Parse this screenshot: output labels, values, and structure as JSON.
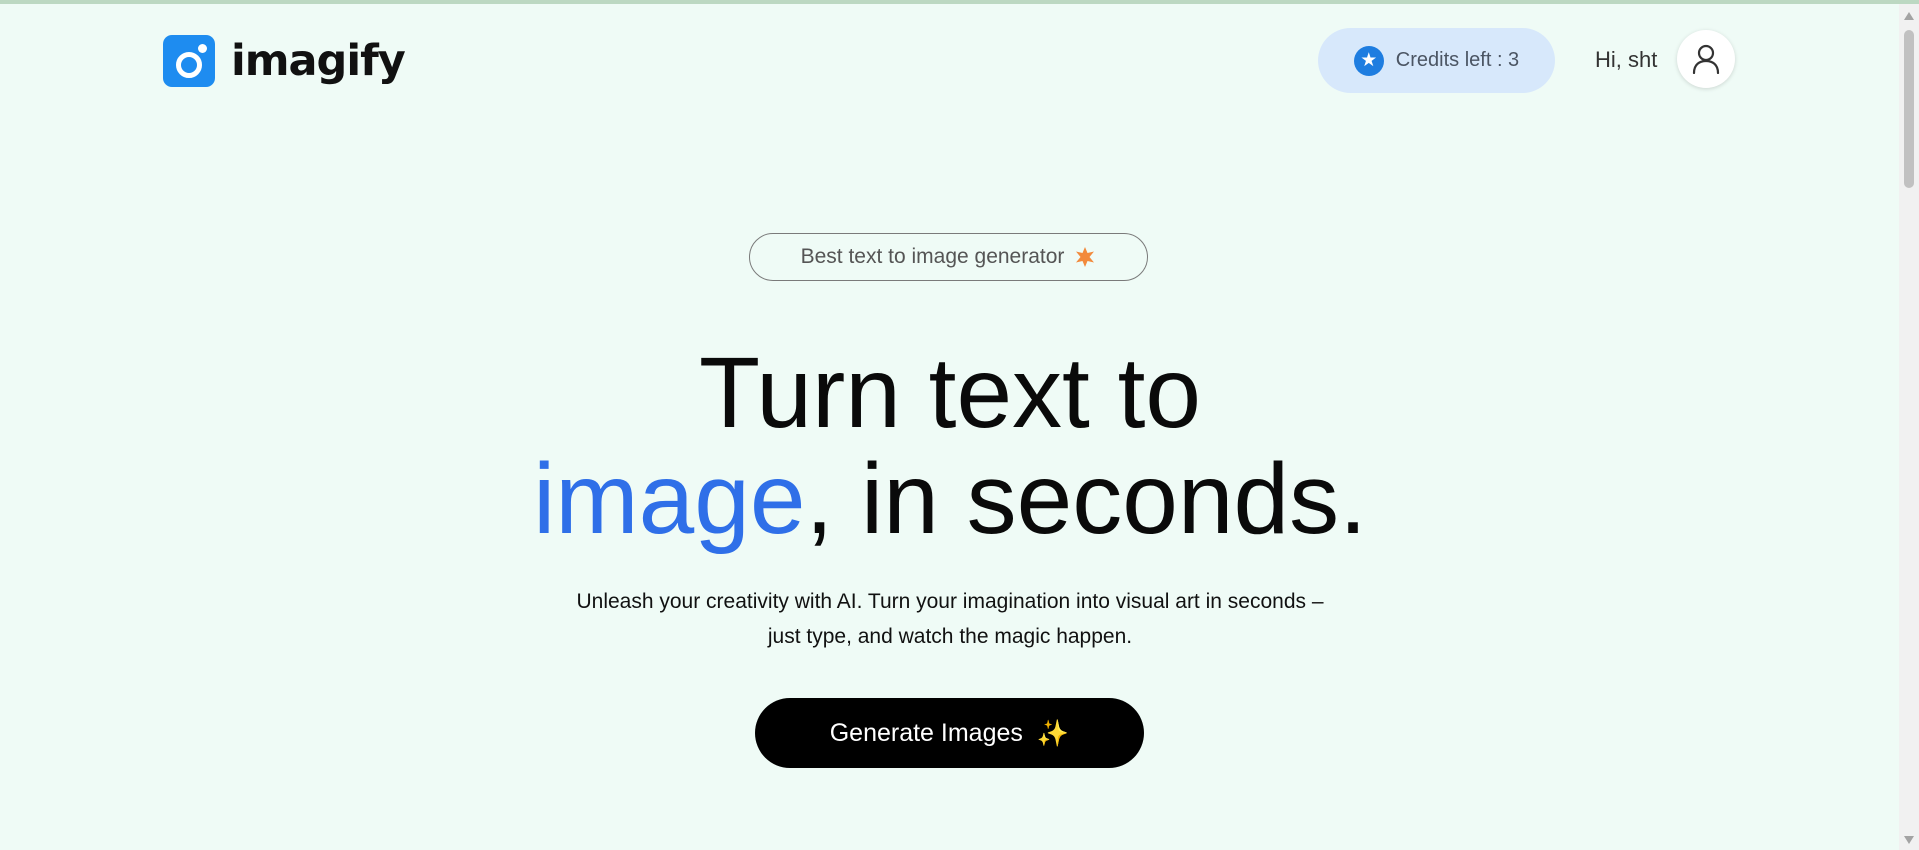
{
  "brand": {
    "name": "imagify",
    "icon": "camera-dot-logo",
    "color": "#1e8cf0"
  },
  "header": {
    "credits_label": "Credits left : 3",
    "credits_icon": "star-icon",
    "greeting": "Hi, sht",
    "avatar_icon": "user-icon"
  },
  "hero": {
    "badge_text": "Best text to image generator",
    "badge_icon": "burst-star-icon",
    "title_part1": "Turn text to",
    "title_accent": "image",
    "title_part2": ", in seconds.",
    "accent_color": "#2f6fe8",
    "subtitle_line1": "Unleash your creativity with AI. Turn your imagination into visual art in seconds –",
    "subtitle_line2": "just type, and watch the magic happen.",
    "cta_label": "Generate Images",
    "cta_icon": "sparkles-icon"
  }
}
